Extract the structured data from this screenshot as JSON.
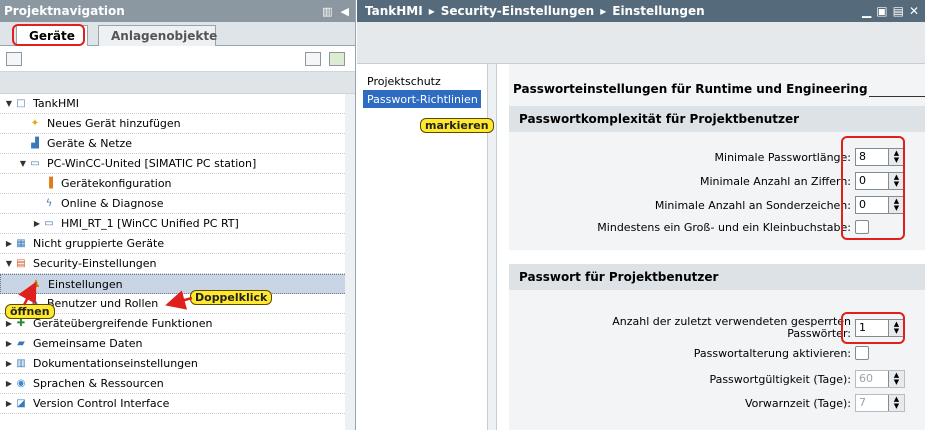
{
  "left_panel": {
    "title": "Projektnavigation",
    "tabs": [
      "Geräte",
      "Anlagenobjekte"
    ],
    "tree": [
      {
        "label": "TankHMI",
        "indent": 0,
        "expander": "▼",
        "icon": "project-icon"
      },
      {
        "label": "Neues Gerät hinzufügen",
        "indent": 1,
        "expander": "",
        "icon": "add-device-icon"
      },
      {
        "label": "Geräte & Netze",
        "indent": 1,
        "expander": "",
        "icon": "network-icon"
      },
      {
        "label": "PC-WinCC-United [SIMATIC PC station]",
        "indent": 1,
        "expander": "▼",
        "icon": "pc-station-icon"
      },
      {
        "label": "Gerätekonfiguration",
        "indent": 2,
        "expander": "",
        "icon": "device-config-icon"
      },
      {
        "label": "Online & Diagnose",
        "indent": 2,
        "expander": "",
        "icon": "diagnose-icon"
      },
      {
        "label": "HMI_RT_1 [WinCC Unified PC RT]",
        "indent": 2,
        "expander": "▶",
        "icon": "hmi-icon"
      },
      {
        "label": "Nicht gruppierte Geräte",
        "indent": 0,
        "expander": "▶",
        "icon": "folder-devices-icon"
      },
      {
        "label": "Security-Einstellungen",
        "indent": 0,
        "expander": "▼",
        "icon": "security-icon"
      },
      {
        "label": "Einstellungen",
        "indent": 1,
        "expander": "",
        "icon": "settings-icon"
      },
      {
        "label": "Benutzer und Rollen",
        "indent": 1,
        "expander": "",
        "icon": "users-icon"
      },
      {
        "label": "Geräteübergreifende Funktionen",
        "indent": 0,
        "expander": "▶",
        "icon": "cross-device-icon"
      },
      {
        "label": "Gemeinsame Daten",
        "indent": 0,
        "expander": "▶",
        "icon": "common-data-icon"
      },
      {
        "label": "Dokumentationseinstellungen",
        "indent": 0,
        "expander": "▶",
        "icon": "documentation-icon"
      },
      {
        "label": "Sprachen & Ressourcen",
        "indent": 0,
        "expander": "▶",
        "icon": "languages-icon"
      },
      {
        "label": "Version Control Interface",
        "indent": 0,
        "expander": "▶",
        "icon": "version-control-icon"
      }
    ],
    "selected_index": 9
  },
  "editor": {
    "breadcrumb": [
      "TankHMI",
      "Security-Einstellungen",
      "Einstellungen"
    ],
    "nav_items": [
      "Projektschutz",
      "Passwort-Richtlinien"
    ],
    "selected_nav": 1,
    "section_title": "Passworteinstellungen für Runtime und Engineering",
    "group1": {
      "title": "Passwortkomplexität für Projektbenutzer",
      "fields": [
        {
          "label": "Minimale Passwortlänge:",
          "type": "spin",
          "value": "8"
        },
        {
          "label": "Minimale Anzahl an Ziffern:",
          "type": "spin",
          "value": "0"
        },
        {
          "label": "Minimale Anzahl an Sonderzeichen:",
          "type": "spin",
          "value": "0"
        },
        {
          "label": "Mindestens ein Groß- und ein Kleinbuchstabe:",
          "type": "check",
          "checked": false
        }
      ]
    },
    "group2": {
      "title": "Passwort für Projektbenutzer",
      "fields": [
        {
          "label": "Anzahl der zuletzt verwendeten gesperrten Passwörter:",
          "type": "spin",
          "value": "1"
        },
        {
          "label": "Passwortalterung aktivieren:",
          "type": "check",
          "checked": false
        },
        {
          "label": "Passwortgültigkeit (Tage):",
          "type": "spin",
          "value": "60",
          "disabled": true
        },
        {
          "label": "Vorwarnzeit (Tage):",
          "type": "spin",
          "value": "7",
          "disabled": true
        }
      ]
    }
  },
  "annotations": {
    "markieren": "markieren",
    "doppelklick": "Doppelklick",
    "oeffnen": "öffnen"
  },
  "colors": {
    "highlight": "#e0201c",
    "callout": "#ffe92e",
    "selection": "#2d6cc0"
  }
}
